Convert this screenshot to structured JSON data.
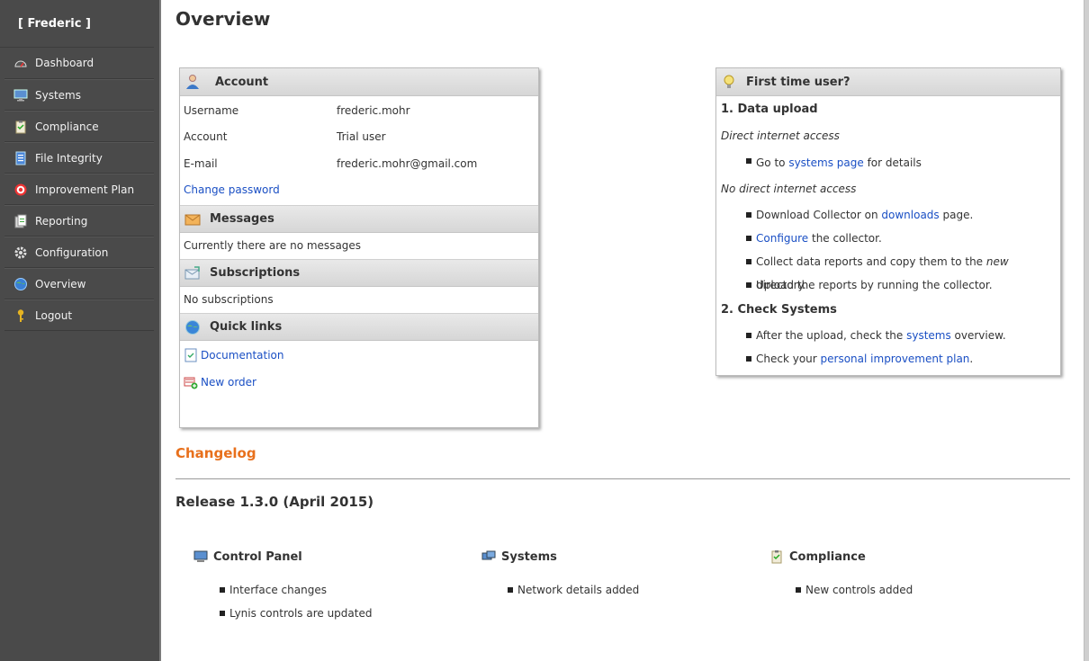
{
  "user": {
    "name": "[ Frederic ]"
  },
  "nav": [
    {
      "label": "Dashboard",
      "icon": "dashboard-gauge-icon"
    },
    {
      "label": "Systems",
      "icon": "monitor-icon"
    },
    {
      "label": "Compliance",
      "icon": "clipboard-icon"
    },
    {
      "label": "File Integrity",
      "icon": "file-icon"
    },
    {
      "label": "Improvement Plan",
      "icon": "target-icon"
    },
    {
      "label": "Reporting",
      "icon": "report-icon"
    },
    {
      "label": "Configuration",
      "icon": "gear-icon"
    },
    {
      "label": "Overview",
      "icon": "globe-icon"
    },
    {
      "label": "Logout",
      "icon": "key-icon"
    }
  ],
  "page_title": "Overview",
  "account": {
    "title": "Account",
    "username_label": "Username",
    "username_value": "frederic.mohr",
    "account_label": "Account",
    "account_value": "Trial user",
    "email_label": "E-mail",
    "email_value": "frederic.mohr@gmail.com",
    "change_password": "Change password"
  },
  "messages": {
    "title": "Messages",
    "text": "Currently there are no messages"
  },
  "subscriptions": {
    "title": "Subscriptions",
    "text": "No subscriptions"
  },
  "quicklinks": {
    "title": "Quick links",
    "documentation": "Documentation",
    "new_order": "New order"
  },
  "ftu": {
    "title": "First time user?",
    "h1": "1. Data upload",
    "direct": "Direct internet access",
    "li1_pre": "Go to ",
    "li1_link": "systems page",
    "li1_post": " for details",
    "nodirect": "No direct internet access",
    "li2_pre": "Download Collector on ",
    "li2_link": "downloads",
    "li2_post": " page.",
    "li3_link": "Configure",
    "li3_post": " the collector.",
    "li4_pre": "Collect data reports and copy them to the ",
    "li4_em": "new",
    "li4_post": " directory.",
    "li5": "Upload the reports by running the collector.",
    "h2": "2. Check Systems",
    "li6_pre": "After the upload, check the ",
    "li6_link": "systems",
    "li6_post": " overview.",
    "li7_pre": "Check your ",
    "li7_link": "personal improvement plan",
    "li7_post": "."
  },
  "changelog": {
    "title": "Changelog",
    "release": "Release 1.3.0 (April 2015)",
    "columns": [
      {
        "title": "Control Panel",
        "items": [
          "Interface changes",
          "Lynis controls are updated"
        ]
      },
      {
        "title": "Systems",
        "items": [
          "Network details added"
        ]
      },
      {
        "title": "Compliance",
        "items": [
          "New controls added"
        ]
      }
    ]
  }
}
